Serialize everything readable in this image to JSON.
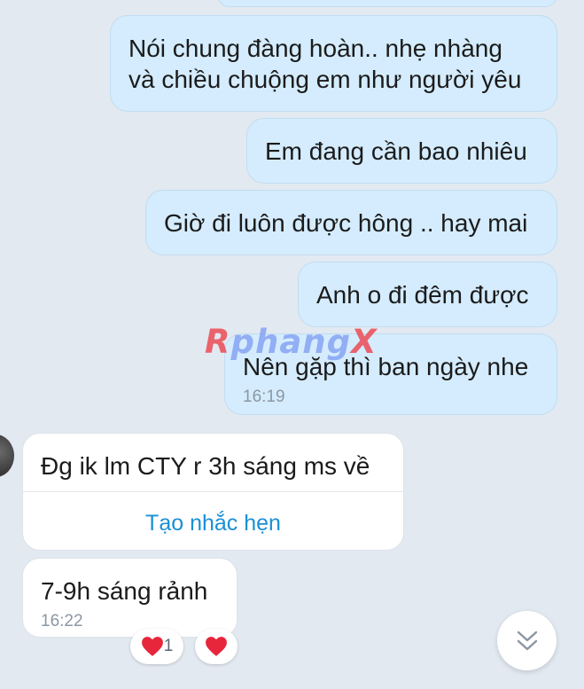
{
  "messages": [
    {
      "id": "m1",
      "direction": "sent",
      "text": "Nói chung đàng hoàn.. nhẹ nhàng\nvà chiều chuộng em như người yêu"
    },
    {
      "id": "m2",
      "direction": "sent",
      "text": "Em đang cần bao nhiêu"
    },
    {
      "id": "m3",
      "direction": "sent",
      "text": "Giờ đi luôn được hông .. hay mai"
    },
    {
      "id": "m4",
      "direction": "sent",
      "text": "Anh o đi đêm được"
    },
    {
      "id": "m5",
      "direction": "sent",
      "text": "Nên gặp thì ban ngày nhe",
      "time": "16:19"
    },
    {
      "id": "m6",
      "direction": "received",
      "text": "Đg ik lm CTY r 3h sáng ms về",
      "action_label": "Tạo nhắc hẹn"
    },
    {
      "id": "m7",
      "direction": "received",
      "text": "7-9h sáng rảnh",
      "time": "16:22"
    }
  ],
  "reactions": {
    "icon": "heart-icon",
    "count": "1",
    "add_icon": "heart-icon",
    "color": "#e8263b"
  },
  "scroll_button": {
    "icon": "chevron-double-down-icon"
  },
  "watermark": {
    "first": "R",
    "middle": "phang",
    "last": "X"
  },
  "colors": {
    "background": "#e2e9f1",
    "sent_bubble": "#d4ecfd",
    "received_bubble": "#ffffff",
    "link": "#1a8fd6",
    "timestamp": "#8c97a3"
  }
}
